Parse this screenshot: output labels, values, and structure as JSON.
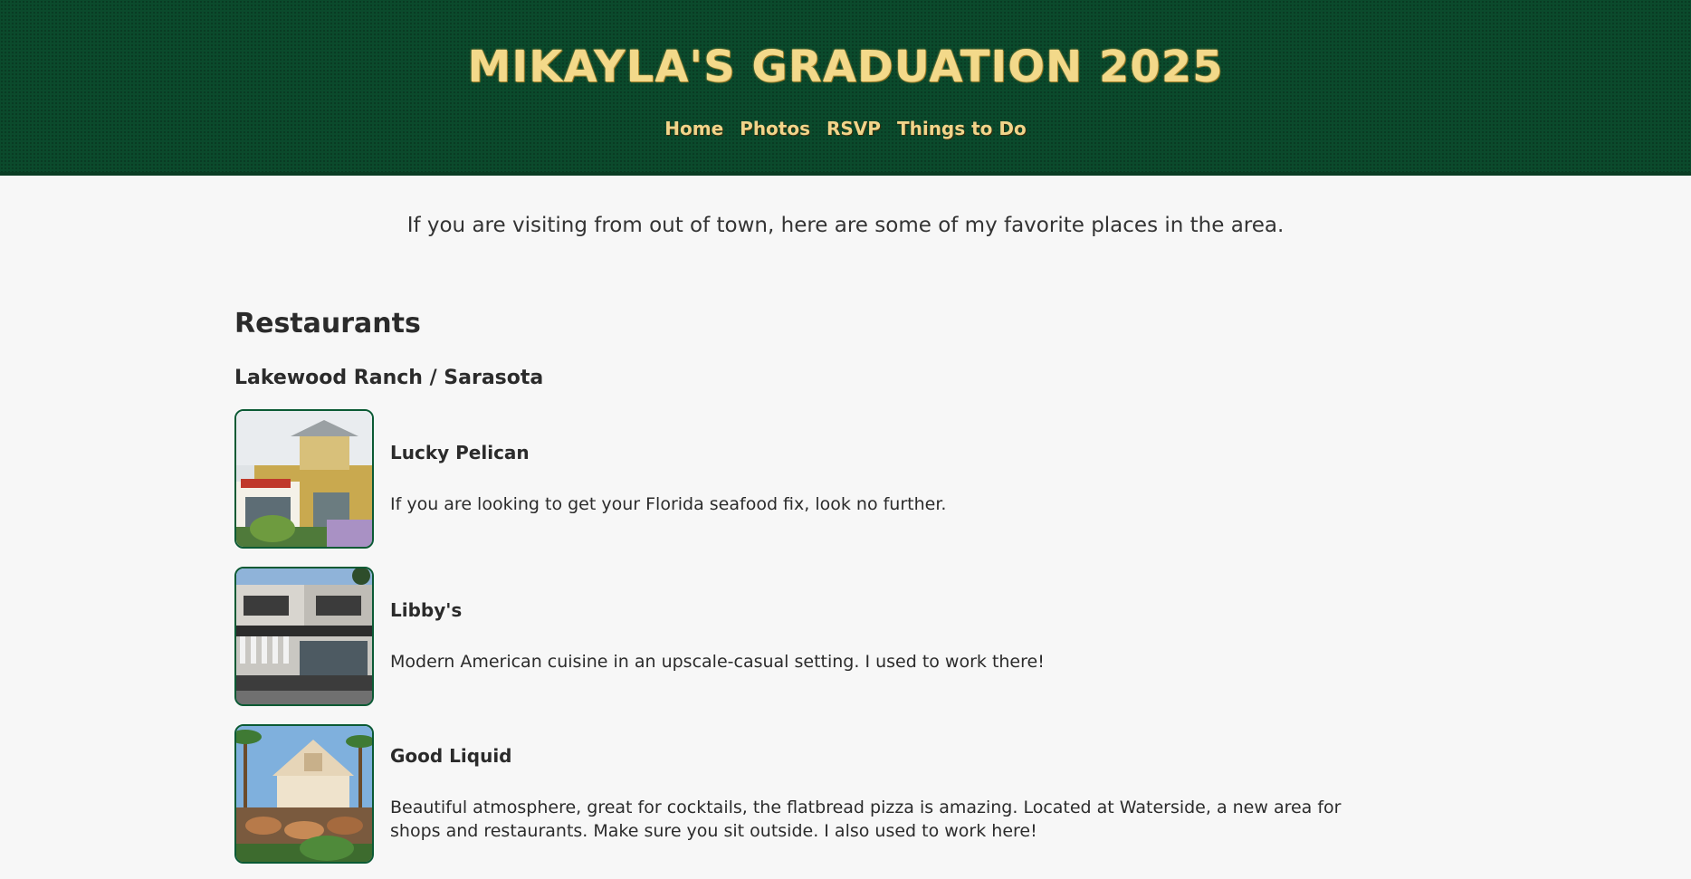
{
  "header": {
    "title": "MIKAYLA'S GRADUATION 2025",
    "nav": [
      "Home",
      "Photos",
      "RSVP",
      "Things to Do"
    ]
  },
  "intro": "If you are visiting from out of town, here are some of my favorite places in the area.",
  "section": {
    "title": "Restaurants",
    "subtitle": "Lakewood Ranch / Sarasota",
    "items": [
      {
        "name": "Lucky Pelican",
        "description": "If you are looking to get your Florida seafood fix, look no further."
      },
      {
        "name": "Libby's",
        "description": "Modern American cuisine in an upscale-casual setting. I used to work there!"
      },
      {
        "name": "Good Liquid",
        "description": "Beautiful atmosphere, great for cocktails, the flatbread pizza is amazing. Located at Waterside, a new area for shops and restaurants. Make sure you sit outside. I also used to work here!"
      }
    ]
  },
  "colors": {
    "header_bg": "#0b4a2c",
    "title_gold": "#f3d98a",
    "page_bg": "#f7f7f7",
    "thumb_border": "#0b5a34"
  }
}
